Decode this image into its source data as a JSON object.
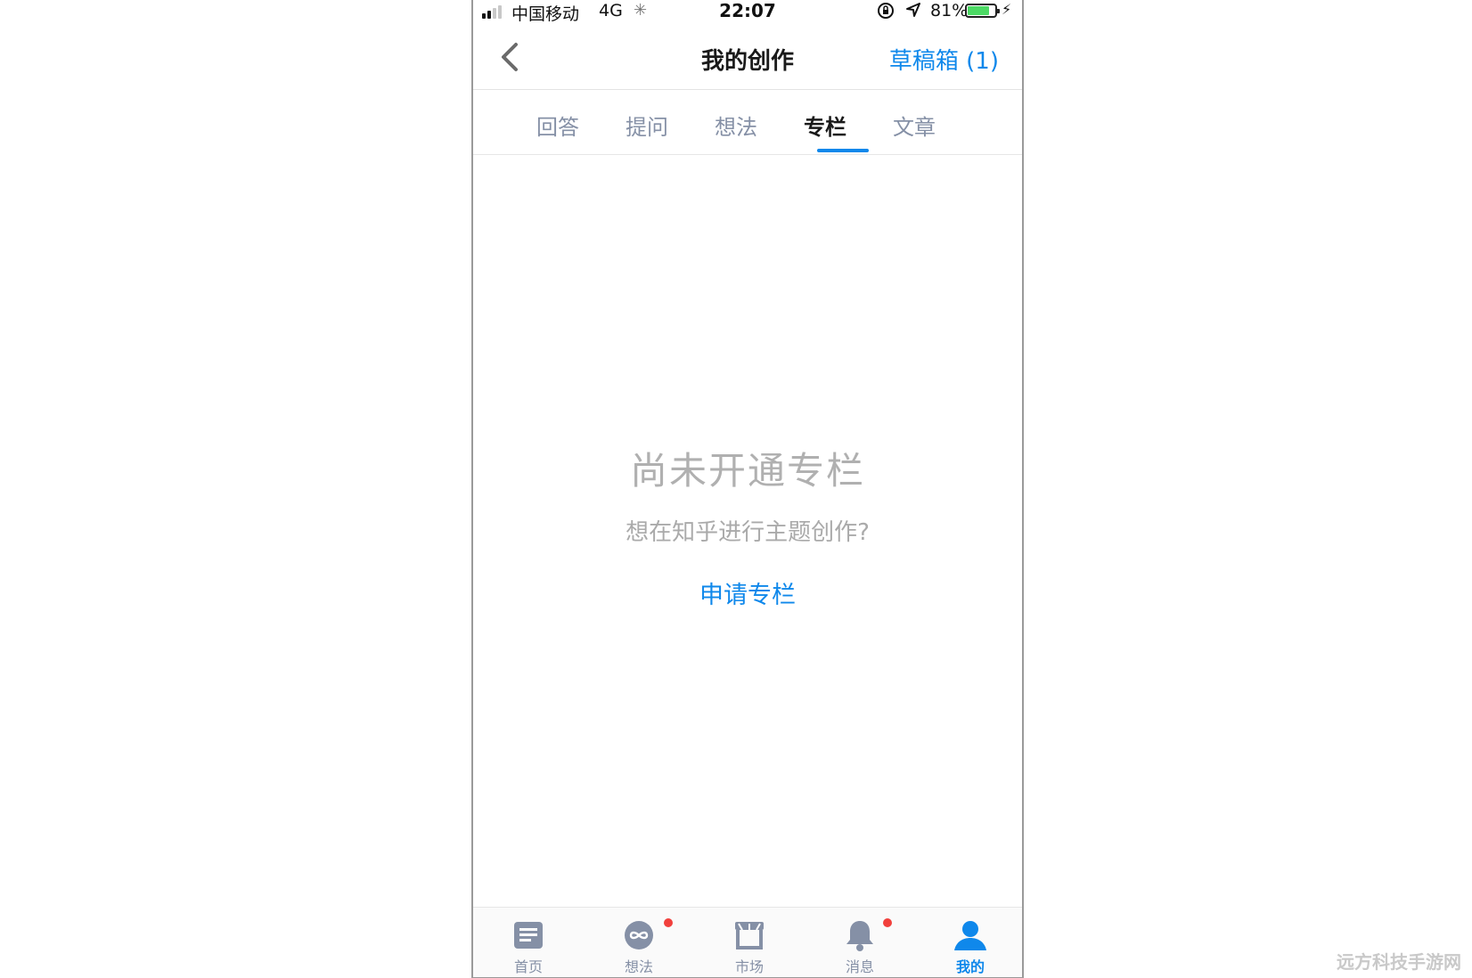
{
  "status_bar": {
    "carrier": "中国移动",
    "network": "4G",
    "time": "22:07",
    "battery_percent": "81%",
    "battery_level": 0.81,
    "icons": [
      "signal-icon",
      "loading-spinner-icon",
      "rotation-lock-icon",
      "location-arrow-icon",
      "battery-icon",
      "charging-bolt-icon"
    ]
  },
  "navbar": {
    "title": "我的创作",
    "drafts_label": "草稿箱 (1)",
    "back_icon": "chevron-left-icon"
  },
  "tabs": [
    {
      "label": "回答",
      "active": false
    },
    {
      "label": "提问",
      "active": false
    },
    {
      "label": "想法",
      "active": false
    },
    {
      "label": "专栏",
      "active": true
    },
    {
      "label": "文章",
      "active": false
    }
  ],
  "empty_state": {
    "title": "尚未开通专栏",
    "subtitle": "想在知乎进行主题创作?",
    "action_label": "申请专栏"
  },
  "tabbar": [
    {
      "label": "首页",
      "icon": "home-feed-icon",
      "badge": false,
      "active": false
    },
    {
      "label": "想法",
      "icon": "ideas-icon",
      "badge": true,
      "active": false
    },
    {
      "label": "市场",
      "icon": "market-store-icon",
      "badge": false,
      "active": false
    },
    {
      "label": "消息",
      "icon": "bell-icon",
      "badge": true,
      "active": false
    },
    {
      "label": "我的",
      "icon": "user-icon",
      "badge": false,
      "active": true
    }
  ],
  "watermark": "远方科技手游网",
  "colors": {
    "accent": "#0f88eb",
    "muted": "#8590a6",
    "badge": "#f1403c",
    "battery": "#4cd964"
  }
}
